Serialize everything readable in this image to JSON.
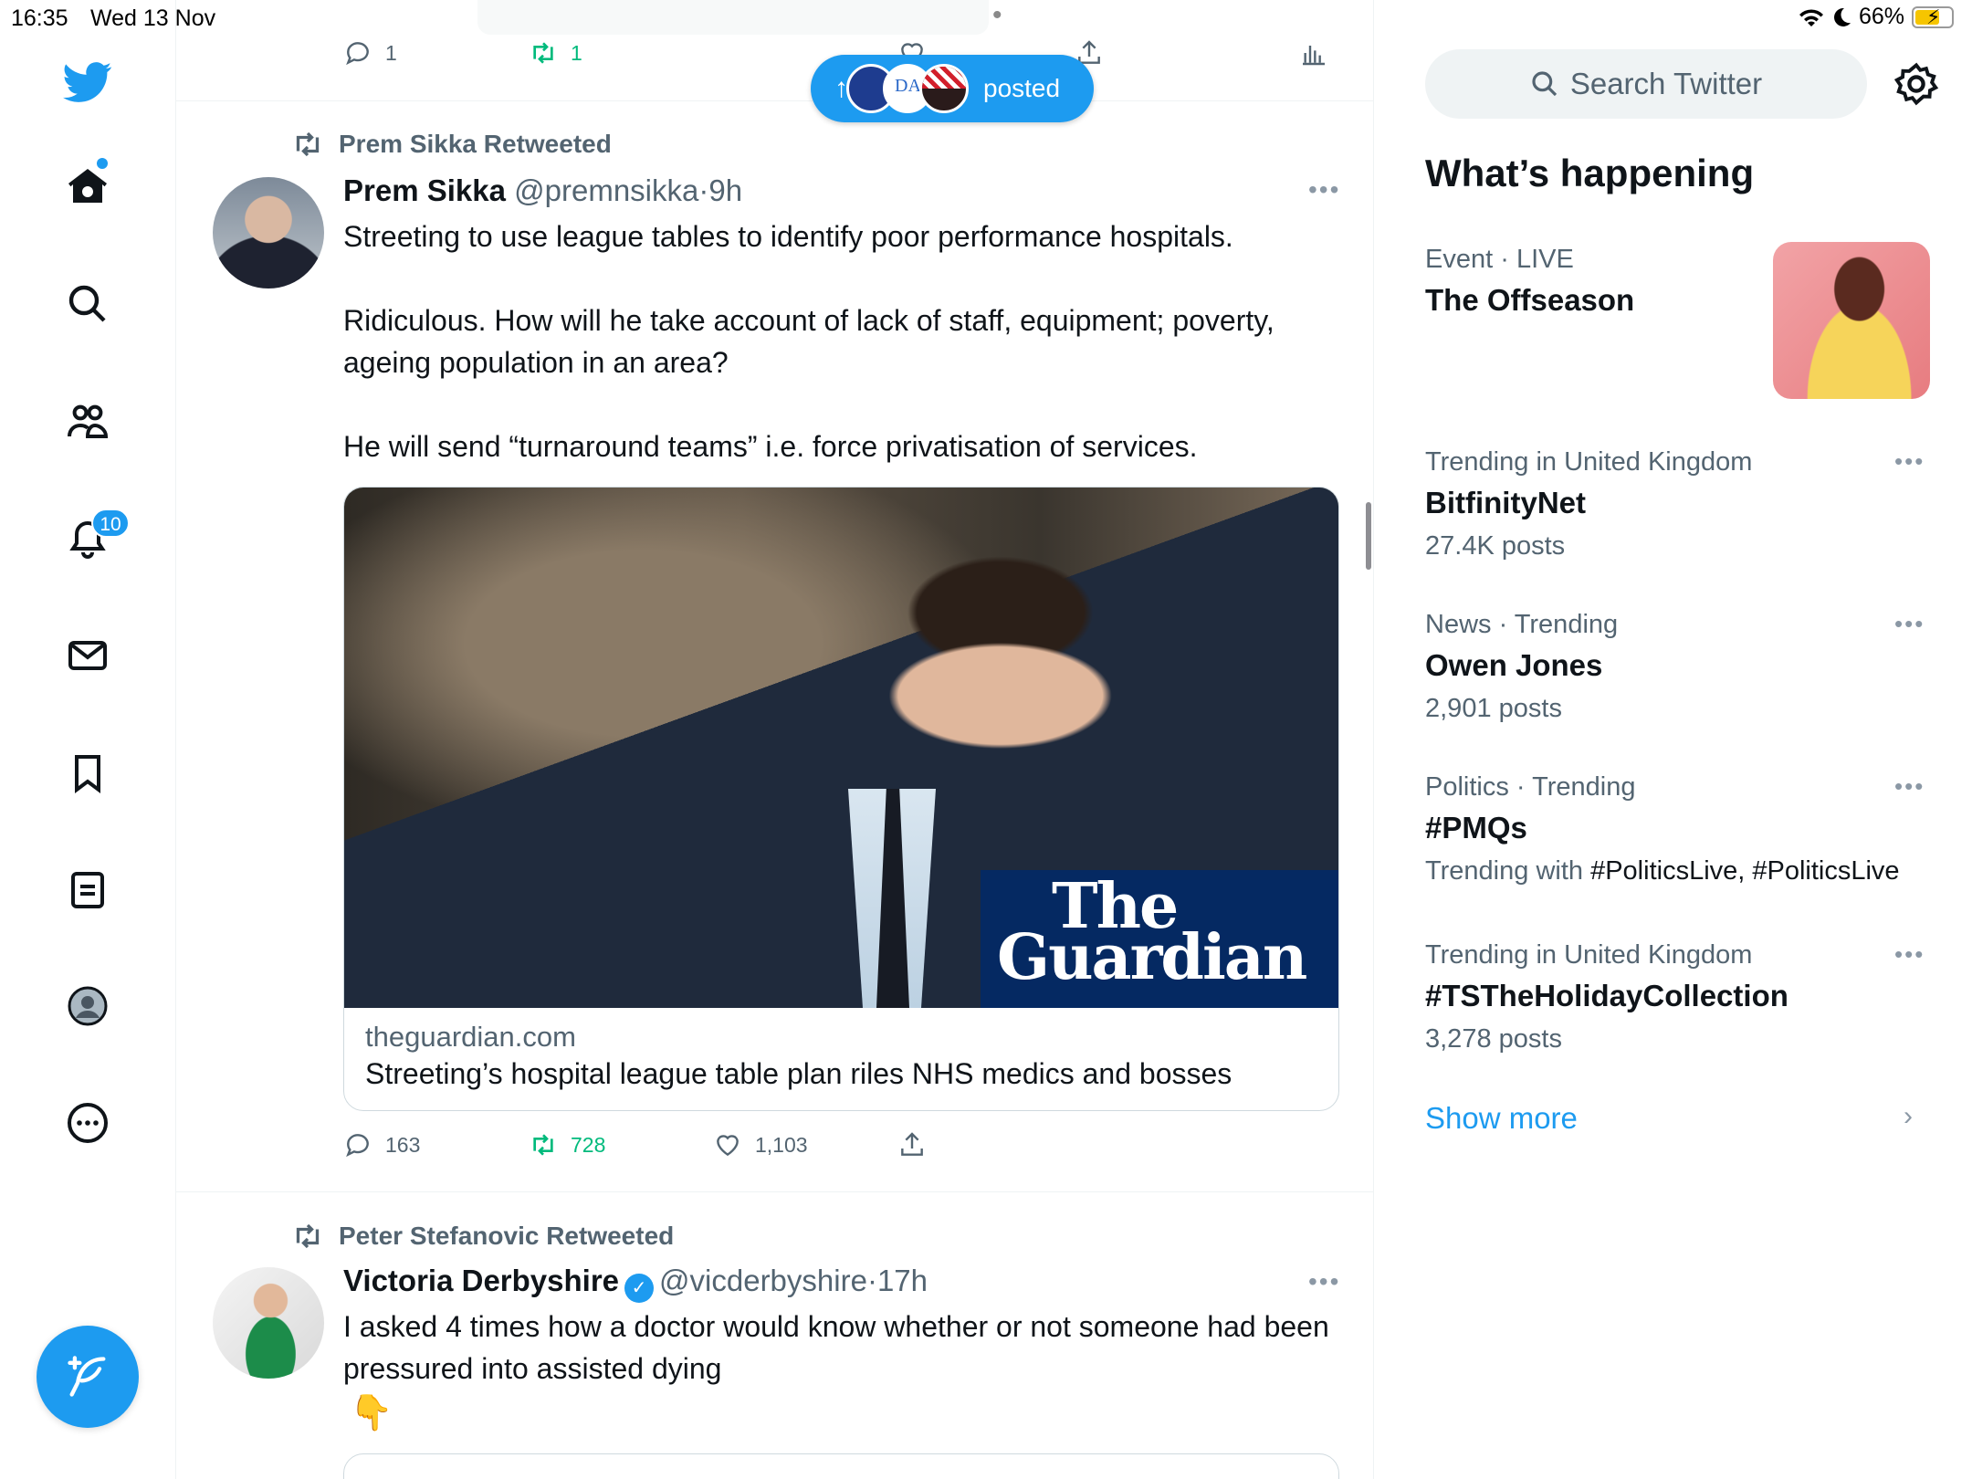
{
  "status_bar": {
    "time": "16:35",
    "date": "Wed 13 Nov",
    "battery": "66%"
  },
  "nav": {
    "notifications_badge": "10"
  },
  "colors": {
    "accent": "#1d9bf0",
    "retweet_green": "#00ba7c",
    "muted": "#536471"
  },
  "top_actions": {
    "replies": "1",
    "retweets": "1"
  },
  "new_posts_pill": {
    "label": "posted"
  },
  "tweet1": {
    "retweeted_by": "Prem Sikka Retweeted",
    "name": "Prem Sikka",
    "handle": "@premnsikka",
    "sep": "·",
    "time": "9h",
    "text": "Streeting to use league tables to identify poor performance hospitals.\n\nRidiculous. How will he take account of lack of staff, equipment; poverty, ageing population in an area?\n\nHe will send “turnaround teams” i.e. force privatisation of services.",
    "card": {
      "logo_line1": "The",
      "logo_line2": "Guardian",
      "domain": "theguardian.com",
      "title": "Streeting’s hospital league table plan riles NHS medics and bosses"
    },
    "replies": "163",
    "retweets": "728",
    "likes": "1,103"
  },
  "tweet2": {
    "retweeted_by": "Peter Stefanovic Retweeted",
    "name": "Victoria Derbyshire",
    "handle": "@vicderbyshire",
    "sep": "·",
    "time": "17h",
    "text": "I asked 4 times how a doctor would know whether or not someone had been pressured into assisted dying",
    "emoji": "👇"
  },
  "sidebar": {
    "search_placeholder": "Search Twitter",
    "whats_happening": "What’s happening",
    "event": {
      "category": "Event",
      "sep": " · ",
      "status": "LIVE",
      "title": "The Offseason"
    },
    "trends": [
      {
        "meta": "Trending in United Kingdom",
        "name": "BitfinityNet",
        "sub": "27.4K posts"
      },
      {
        "meta": "News · Trending",
        "name": "Owen Jones",
        "sub": "2,901 posts"
      },
      {
        "meta": "Politics · Trending",
        "name": "#PMQs",
        "sub_prefix": "Trending with ",
        "sub_tags": "#PoliticsLive, #PoliticsLive"
      },
      {
        "meta": "Trending in United Kingdom",
        "name": "#TSTheHolidayCollection",
        "sub": "3,278 posts"
      }
    ],
    "show_more": "Show more"
  }
}
